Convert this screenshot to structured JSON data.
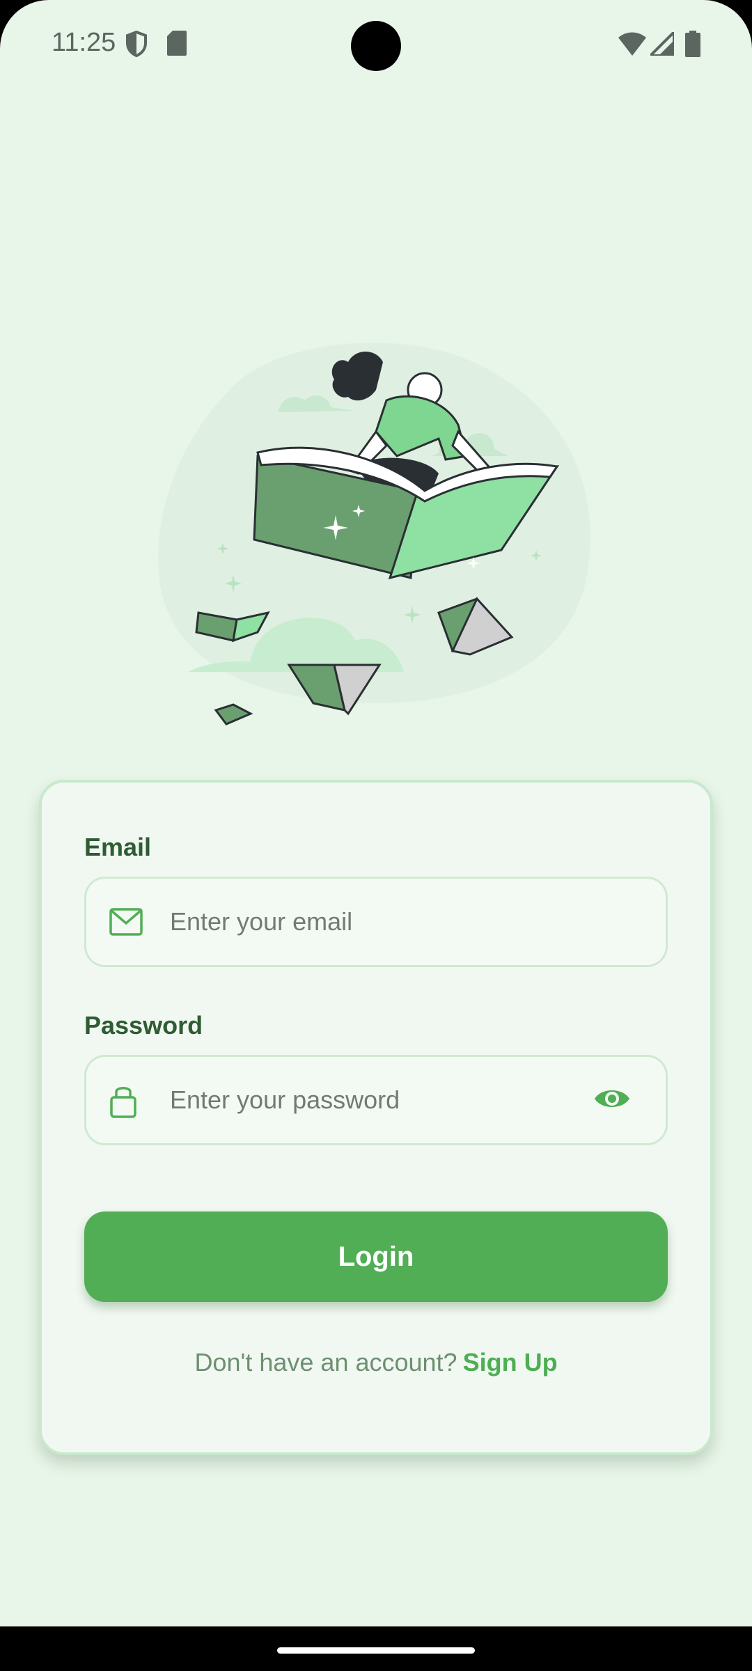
{
  "status_bar": {
    "time": "11:25",
    "icons": [
      "shield-icon",
      "sd-card-icon",
      "wifi-icon",
      "signal-icon",
      "battery-icon"
    ]
  },
  "form": {
    "email_label": "Email",
    "email_placeholder": "Enter your email",
    "password_label": "Password",
    "password_placeholder": "Enter your password",
    "login_label": "Login",
    "signup_prompt": "Don't have an account?",
    "signup_link": "Sign Up"
  },
  "colors": {
    "background": "#e8f5e9",
    "accent": "#51ae55",
    "label": "#2e5c33"
  }
}
